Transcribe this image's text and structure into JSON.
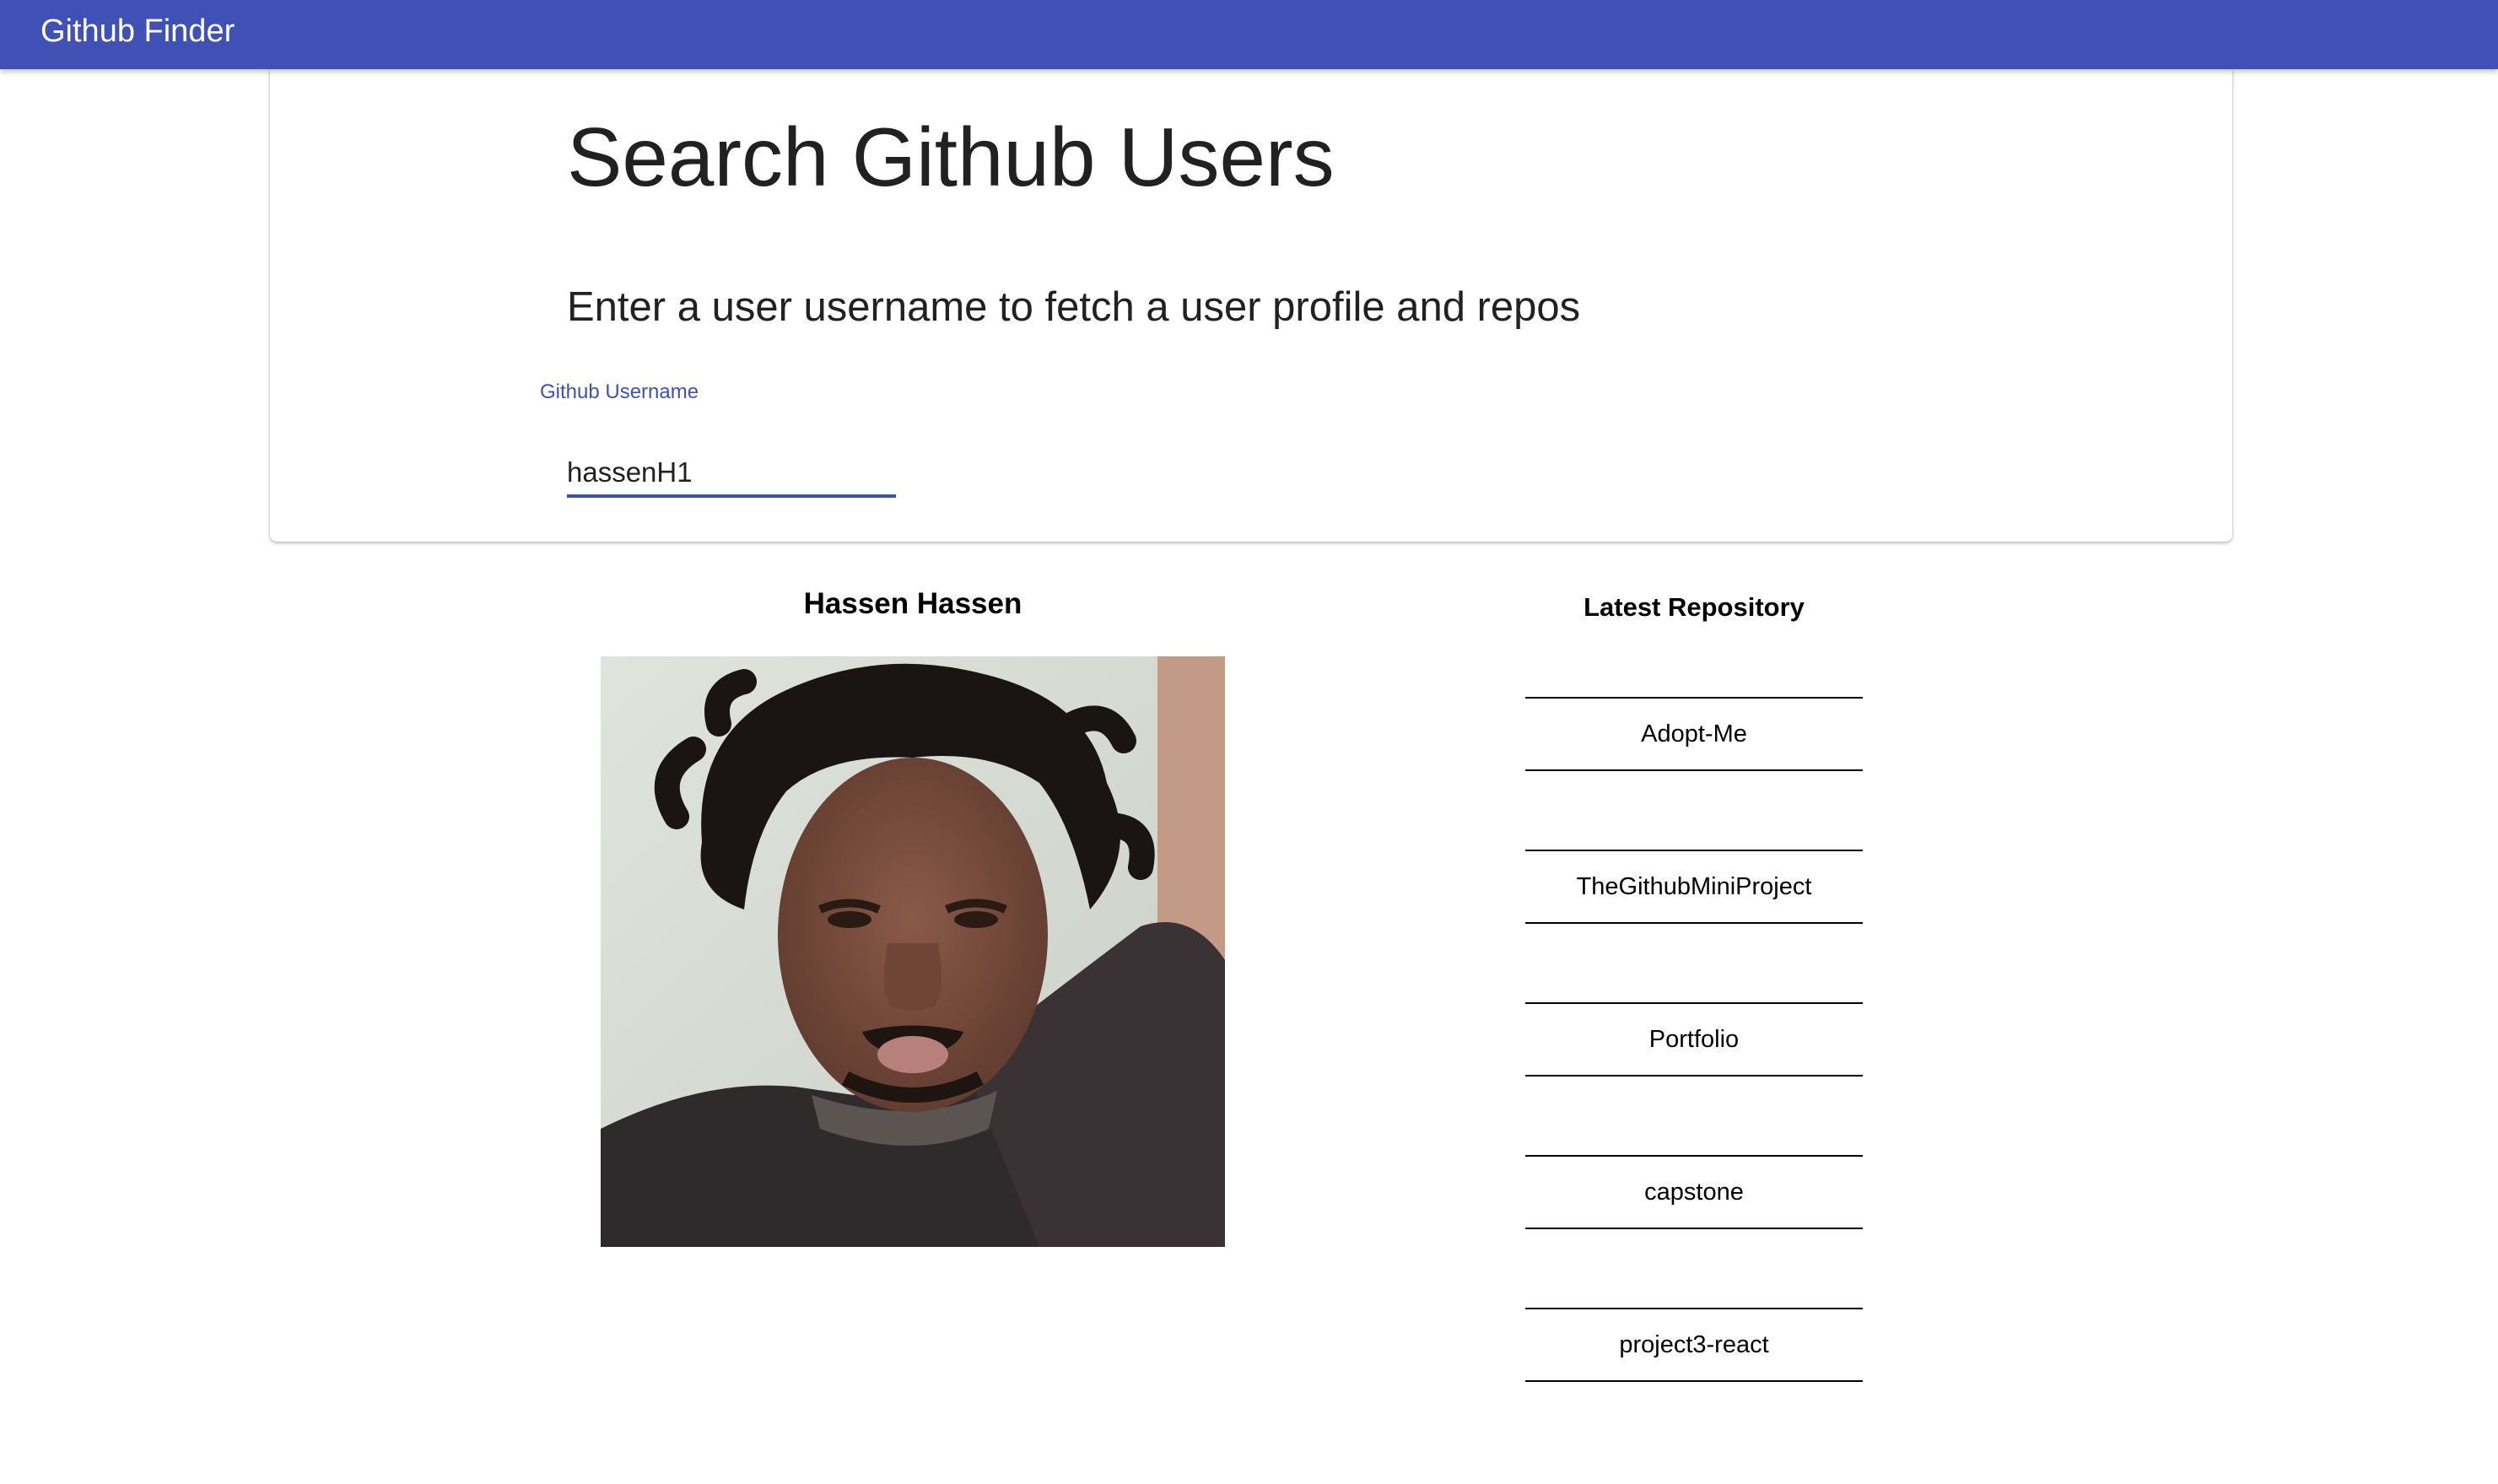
{
  "app": {
    "title": "Github Finder",
    "accent_color": "#3f51b5"
  },
  "search": {
    "title": "Search Github Users",
    "subtitle": "Enter a user username to fetch a user profile and repos",
    "field_label": "Github Username",
    "input_value": "hassenH1"
  },
  "profile": {
    "name": "Hassen Hassen",
    "avatar_icon": "user-avatar-photo"
  },
  "repos": {
    "heading": "Latest Repository",
    "items": [
      {
        "name": "Adopt-Me"
      },
      {
        "name": "TheGithubMiniProject"
      },
      {
        "name": "Portfolio"
      },
      {
        "name": "capstone"
      },
      {
        "name": "project3-react"
      }
    ]
  }
}
